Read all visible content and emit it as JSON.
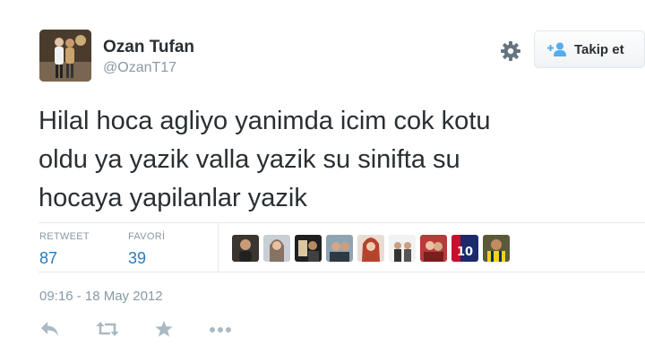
{
  "user": {
    "name": "Ozan Tufan",
    "handle": "@OzanT17"
  },
  "follow_button": {
    "label": "Takip et"
  },
  "tweet": {
    "lines": [
      "Hilal hoca agliyo yanimda icim cok kotu",
      "oldu ya yazik valla yazik su sinifta su",
      "hocaya yapilanlar yazik"
    ],
    "timestamp": "09:16 - 18 May 2012"
  },
  "stats": {
    "retweet": {
      "label": "RETWEET",
      "value": "87"
    },
    "favorite": {
      "label": "FAVORİ",
      "value": "39"
    }
  },
  "icons": {
    "settings": "gear-icon",
    "follow": "add-user-icon",
    "reply": "reply-icon",
    "retweet": "retweet-icon",
    "favorite": "star-icon",
    "more": "more-icon"
  },
  "colors": {
    "link_blue": "#2b7bb9",
    "muted_gray": "#8899a6",
    "icon_gray": "#aab8c2",
    "text": "#292f33"
  }
}
